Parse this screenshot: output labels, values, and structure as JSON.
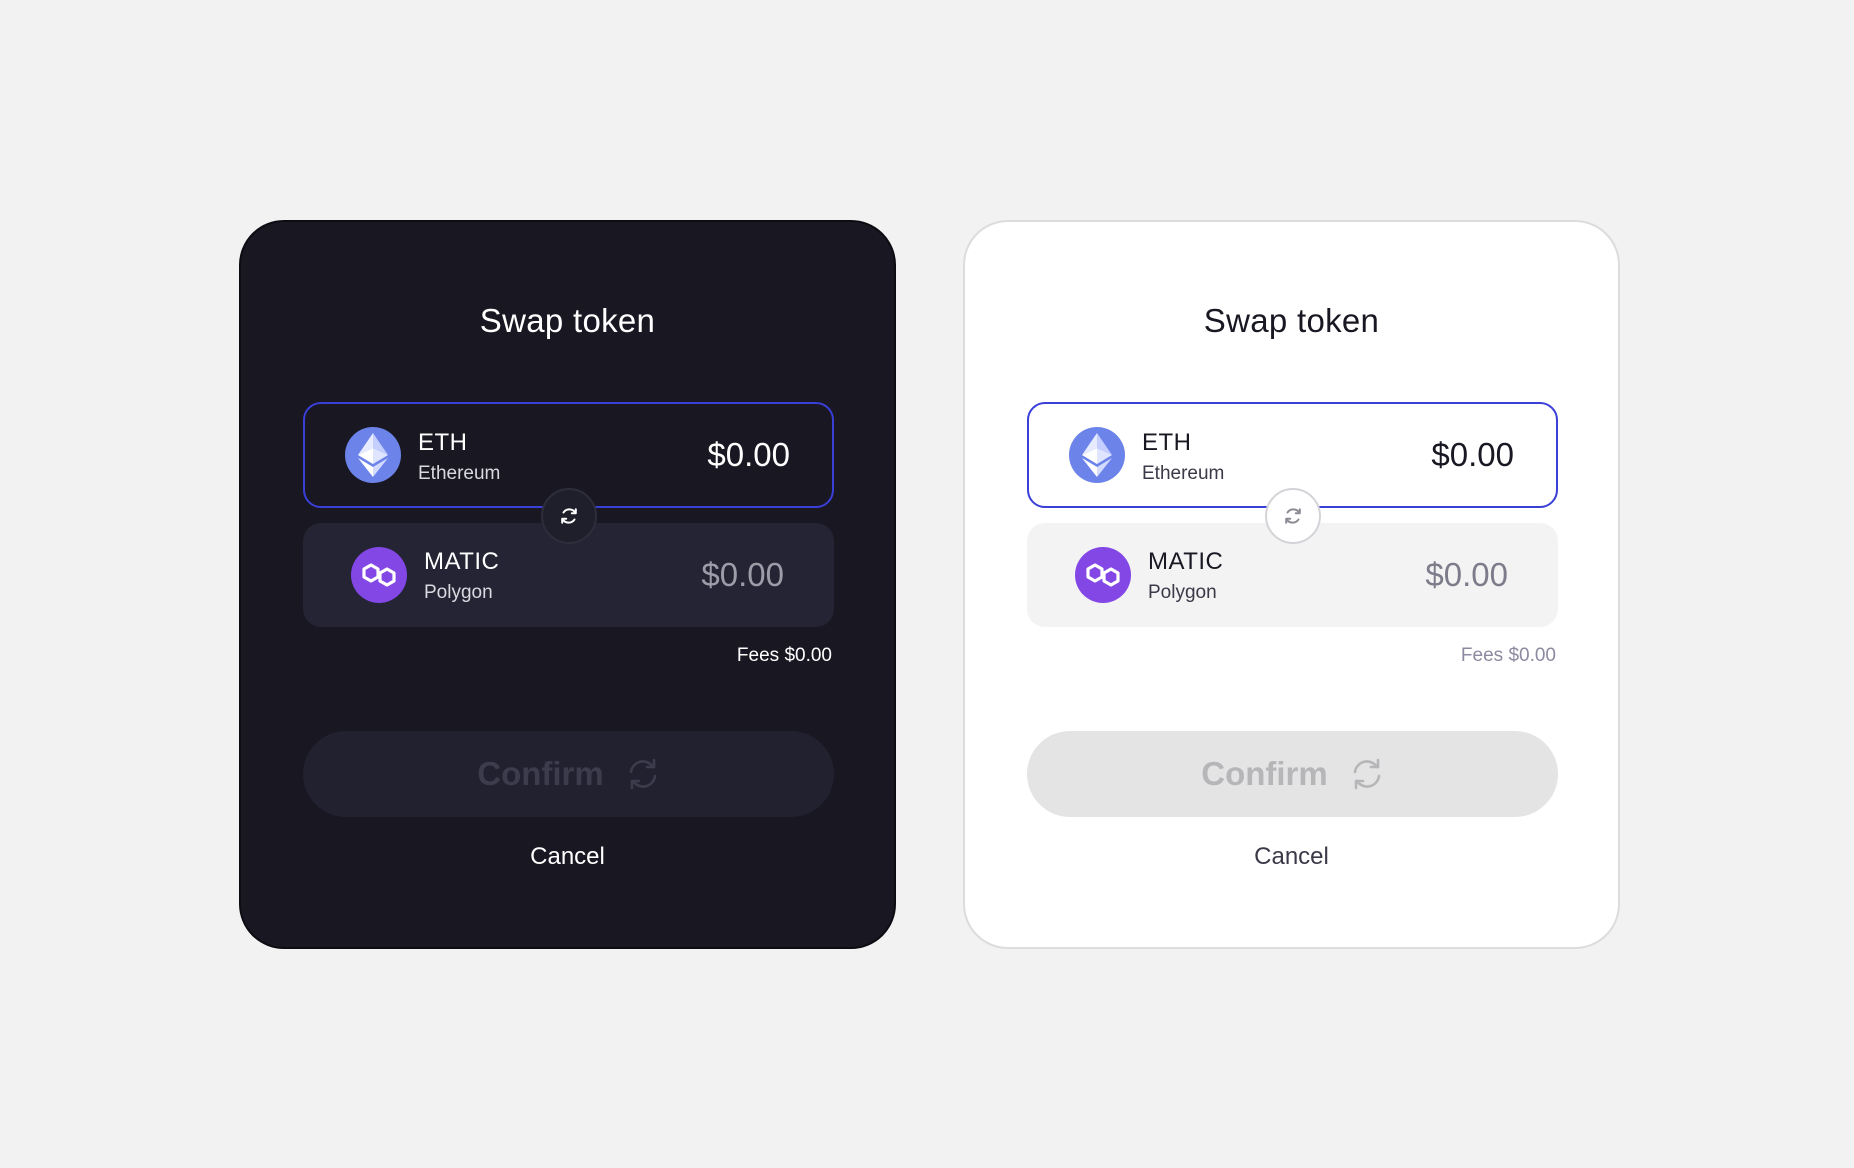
{
  "panels": [
    {
      "theme": "dark",
      "title": "Swap token",
      "from": {
        "symbol": "ETH",
        "name": "Ethereum",
        "amount": "$0.00",
        "icon": "ethereum-icon"
      },
      "to": {
        "symbol": "MATIC",
        "name": "Polygon",
        "amount": "$0.00",
        "icon": "polygon-icon"
      },
      "fees": "Fees $0.00",
      "confirm_label": "Confirm",
      "cancel_label": "Cancel"
    },
    {
      "theme": "light",
      "title": "Swap token",
      "from": {
        "symbol": "ETH",
        "name": "Ethereum",
        "amount": "$0.00",
        "icon": "ethereum-icon"
      },
      "to": {
        "symbol": "MATIC",
        "name": "Polygon",
        "amount": "$0.00",
        "icon": "polygon-icon"
      },
      "fees": "Fees $0.00",
      "confirm_label": "Confirm",
      "cancel_label": "Cancel"
    }
  ],
  "colors": {
    "accent_border": "#3a3fd8",
    "ethereum": "#6c83ea",
    "polygon": "#8247e5",
    "dark_bg": "#181722",
    "light_bg": "#ffffff",
    "page_bg": "#f2f2f2"
  }
}
